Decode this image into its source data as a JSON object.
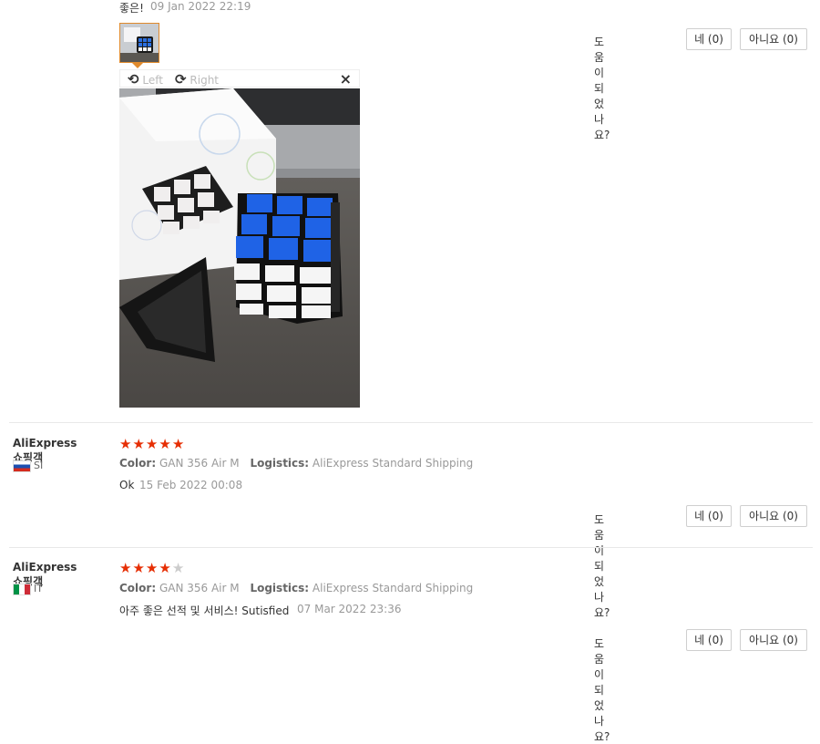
{
  "review1": {
    "text": "좋은!",
    "date": "09 Jan 2022 22:19",
    "helpful": {
      "question": "도움이 되었나요?",
      "yes": "네 (0)",
      "no": "아니요 (0)"
    },
    "viewer": {
      "rotate_left": "Left",
      "rotate_right": "Right",
      "close": "×"
    }
  },
  "review2": {
    "reviewer": "AliExpress 쇼핑객",
    "country": "SI",
    "rating": 5,
    "stars": {
      "s1": "★",
      "s2": "★",
      "s3": "★",
      "s4": "★",
      "s5": "★"
    },
    "color_label": "Color:",
    "color_value": "GAN 356 Air M",
    "logistics_label": "Logistics:",
    "logistics_value": "AliExpress Standard Shipping",
    "text": "Ok",
    "date": "15 Feb 2022 00:08",
    "helpful": {
      "question": "도움이 되었나요?",
      "yes": "네 (0)",
      "no": "아니요 (0)"
    }
  },
  "review3": {
    "reviewer": "AliExpress 쇼핑객",
    "country": "IT",
    "rating": 4,
    "stars": {
      "s1": "★",
      "s2": "★",
      "s3": "★",
      "s4": "★",
      "s5": "★"
    },
    "color_label": "Color:",
    "color_value": "GAN 356 Air M",
    "logistics_label": "Logistics:",
    "logistics_value": "AliExpress Standard Shipping",
    "text": "아주 좋은 선적 및 서비스! Sutisfied",
    "date": "07 Mar 2022 23:36",
    "helpful": {
      "question": "도움이 되었나요?",
      "yes": "네 (0)",
      "no": "아니요 (0)"
    }
  },
  "colors": {
    "star": "#e62e04",
    "thumb_border": "#e08a2c",
    "divider": "#e8e8e8"
  }
}
